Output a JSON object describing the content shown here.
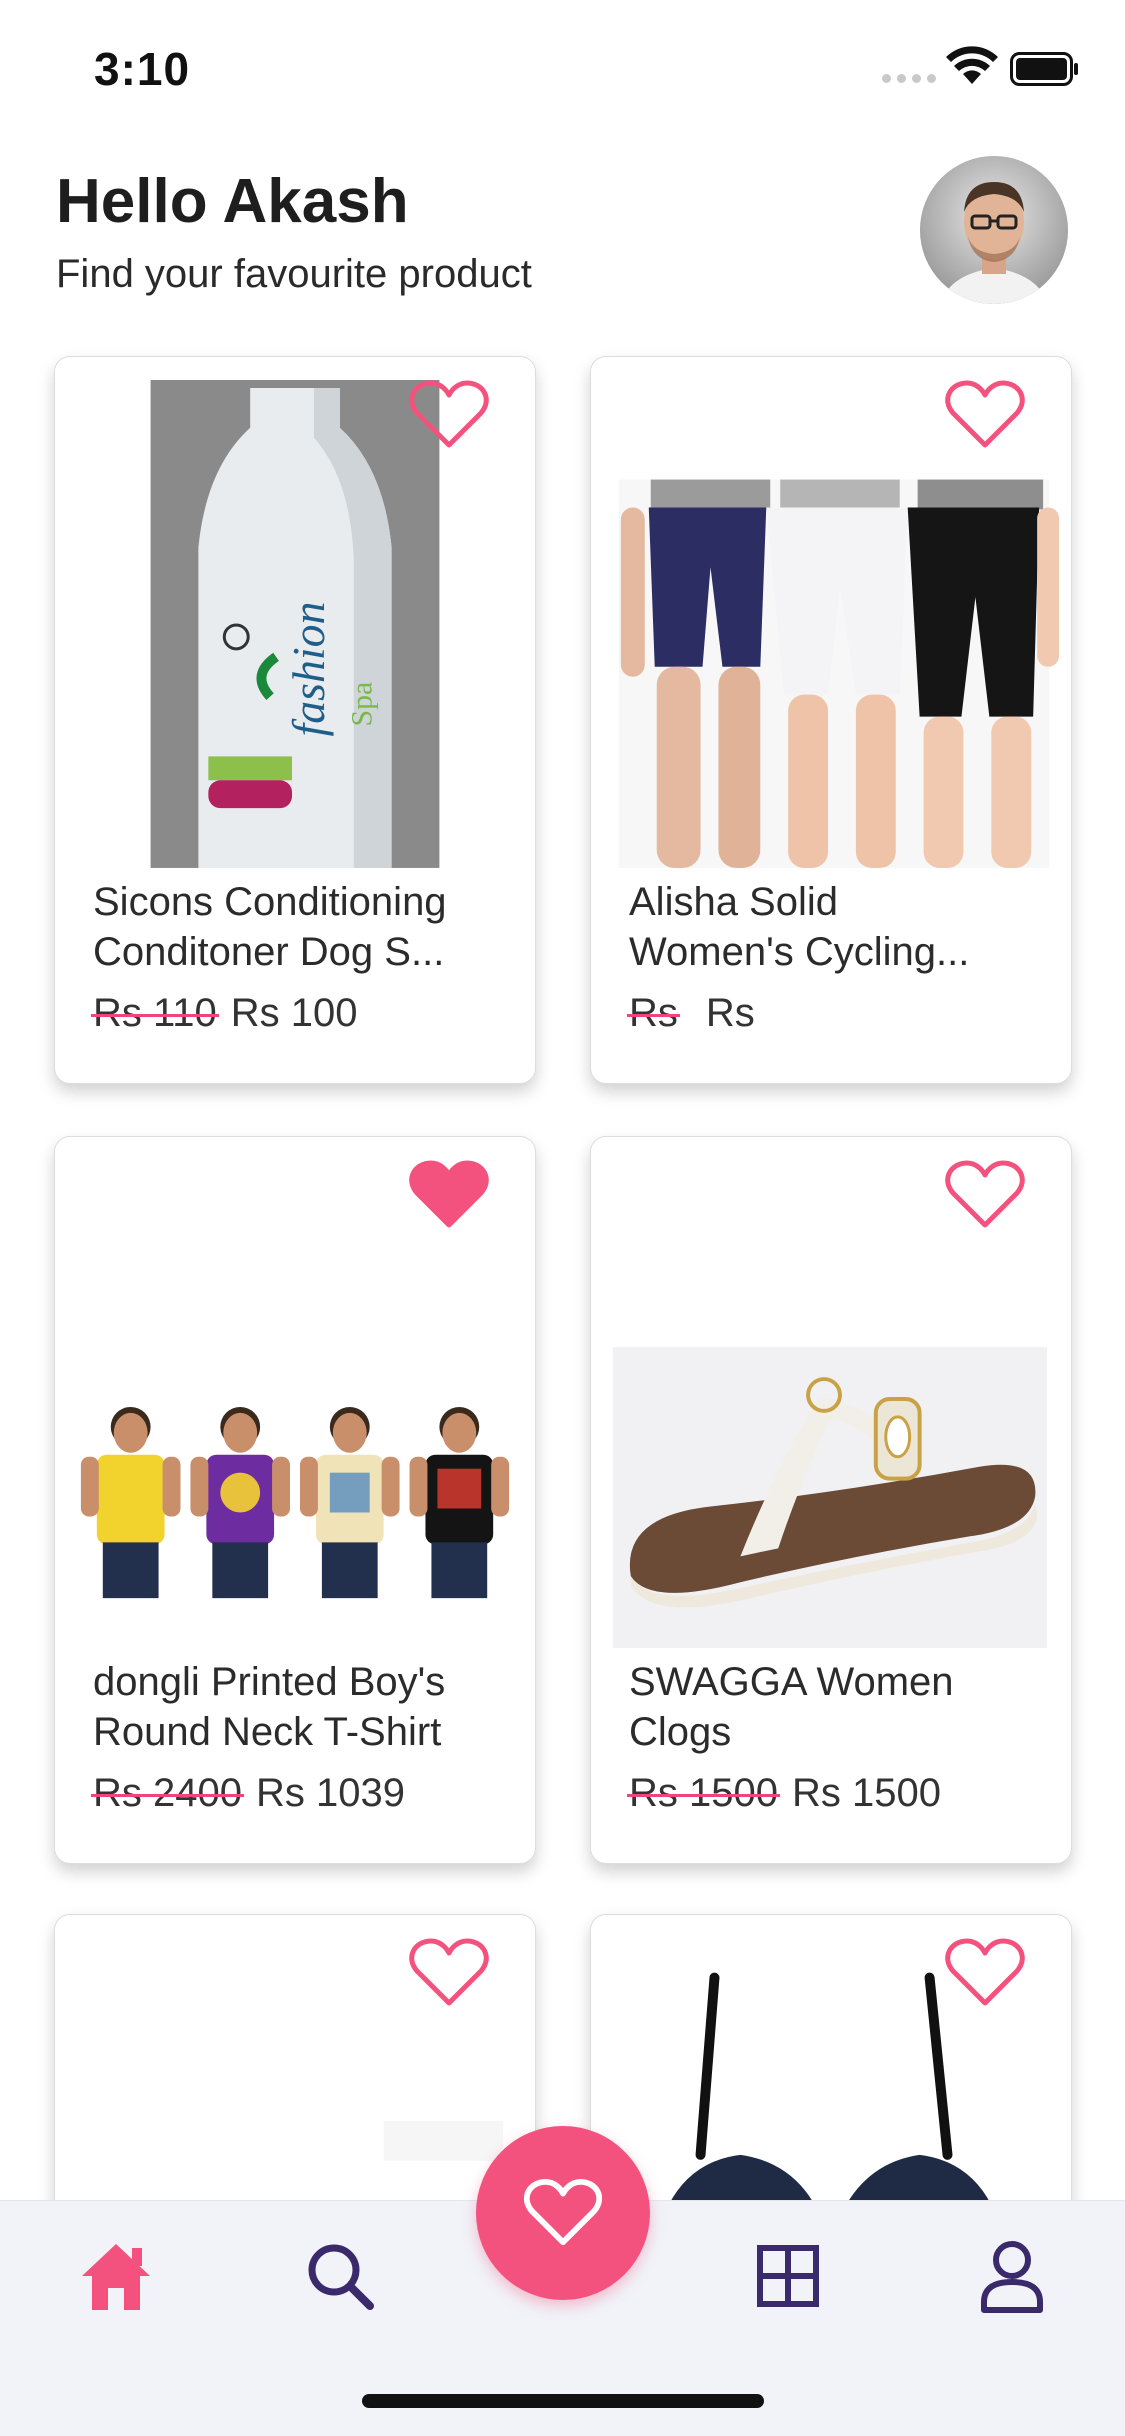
{
  "status_bar": {
    "time": "3:10"
  },
  "header": {
    "greeting": "Hello Akash",
    "subtitle": "Find your favourite product"
  },
  "products": [
    {
      "title_line1": "Sicons Conditioning",
      "title_line2": "Conditoner Dog S...",
      "price_old": "Rs 110",
      "price_new": "Rs 100",
      "favorited": false,
      "image": "dog-shampoo-bottle"
    },
    {
      "title_line1": "Alisha Solid",
      "title_line2": "Women's Cycling...",
      "price_old": "Rs",
      "price_new": "Rs",
      "favorited": false,
      "image": "cycling-shorts"
    },
    {
      "title_line1": "dongli Printed Boy's",
      "title_line2": "Round Neck T-Shirt",
      "price_old": "Rs 2400",
      "price_new": "Rs 1039",
      "favorited": true,
      "image": "boys-tshirts"
    },
    {
      "title_line1": "SWAGGA Women",
      "title_line2": "Clogs",
      "price_old": "Rs 1500",
      "price_new": "Rs 1500",
      "favorited": false,
      "image": "women-clogs"
    },
    {
      "favorited": false,
      "image": "blank-product"
    },
    {
      "favorited": false,
      "image": "bra"
    }
  ],
  "colors": {
    "accent": "#f4527e",
    "nav_inactive": "#3b2a6b"
  },
  "nav": {
    "items": [
      "home-icon",
      "search-icon",
      "favorites-fab",
      "grid-icon",
      "profile-icon"
    ],
    "active": "home-icon"
  }
}
